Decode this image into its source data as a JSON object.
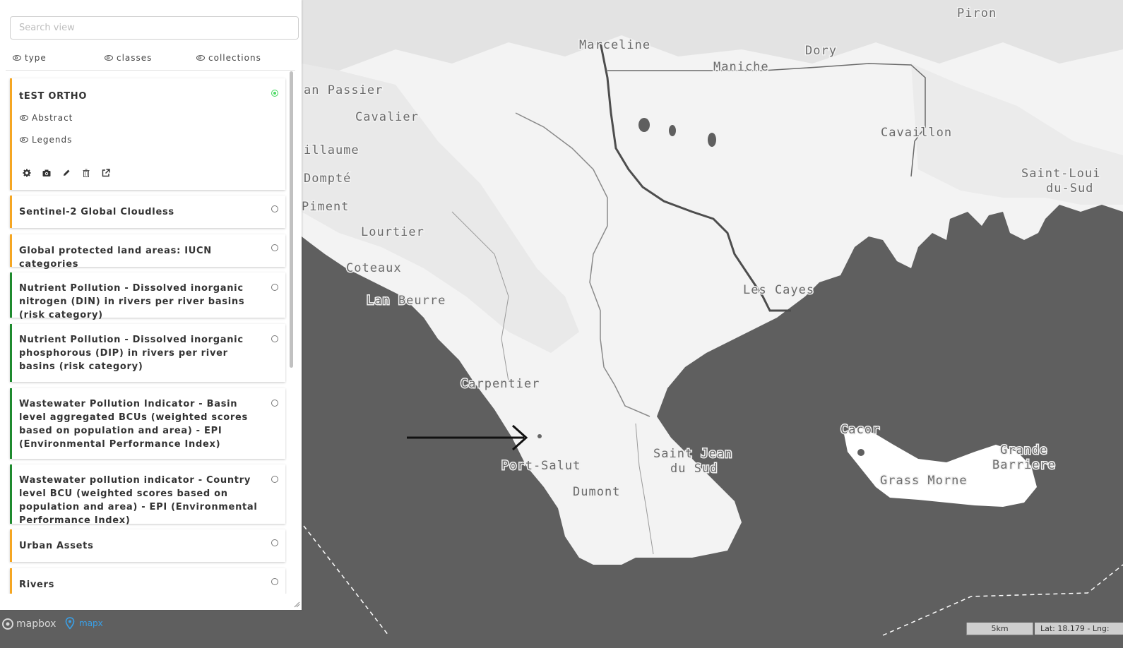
{
  "search": {
    "placeholder": "Search view"
  },
  "filters": [
    {
      "label": "type"
    },
    {
      "label": "classes"
    },
    {
      "label": "collections"
    }
  ],
  "views": [
    {
      "title": "tEST ORTHO",
      "active": true,
      "expanded": true,
      "sub_toggles": [
        "Abstract",
        "Legends"
      ],
      "tools": [
        "gear-icon",
        "camera-icon",
        "pencil-icon",
        "trash-icon",
        "external-link-icon"
      ]
    },
    {
      "title": "Sentinel-2 Global Cloudless",
      "active": false
    },
    {
      "title": "Global protected land areas: IUCN categories",
      "active": false
    },
    {
      "title": "Nutrient Pollution - Dissolved inorganic nitrogen (DIN) in rivers per river basins (risk category)",
      "active": false
    },
    {
      "title": "Nutrient Pollution - Dissolved inorganic phosphorous (DIP) in rivers per river basins (risk category)",
      "active": false
    },
    {
      "title": "Wastewater Pollution Indicator - Basin level aggregated BCUs (weighted scores based on population and area) - EPI (Environmental Performance Index)",
      "active": false
    },
    {
      "title": "Wastewater pollution indicator - Country level BCU (weighted scores based on population and area) - EPI (Environmental Performance Index)",
      "active": false
    },
    {
      "title": "Urban Assets",
      "active": false
    },
    {
      "title": "Rivers",
      "active": false
    }
  ],
  "map": {
    "places": [
      "Piron",
      "Marceline",
      "Dory",
      "Maniche",
      "an Passier",
      "Cavalier",
      "Cavaillon",
      "illaume",
      "Dompté",
      "Saint-Loui",
      "du-Sud",
      "Piment",
      "Lourtier",
      "Coteaux",
      "Les Cayes",
      "Lan Beurre",
      "Carpentier",
      "Cacor",
      "Grande",
      "Barriere",
      "Saint Jean",
      "du Sud",
      "Port-Salut",
      "Dumont",
      "Grass Morne"
    ]
  },
  "footer": {
    "mapbox": "mapbox",
    "mapx": "mapx",
    "scale": "5km",
    "coords": "Lat: 18.179 - Lng:"
  },
  "colors": {
    "land": "#f4f4f4",
    "water": "#5f5f5f",
    "accent_orange": "#f5a623",
    "accent_green": "#1e8a2e",
    "active": "#4cd964"
  }
}
